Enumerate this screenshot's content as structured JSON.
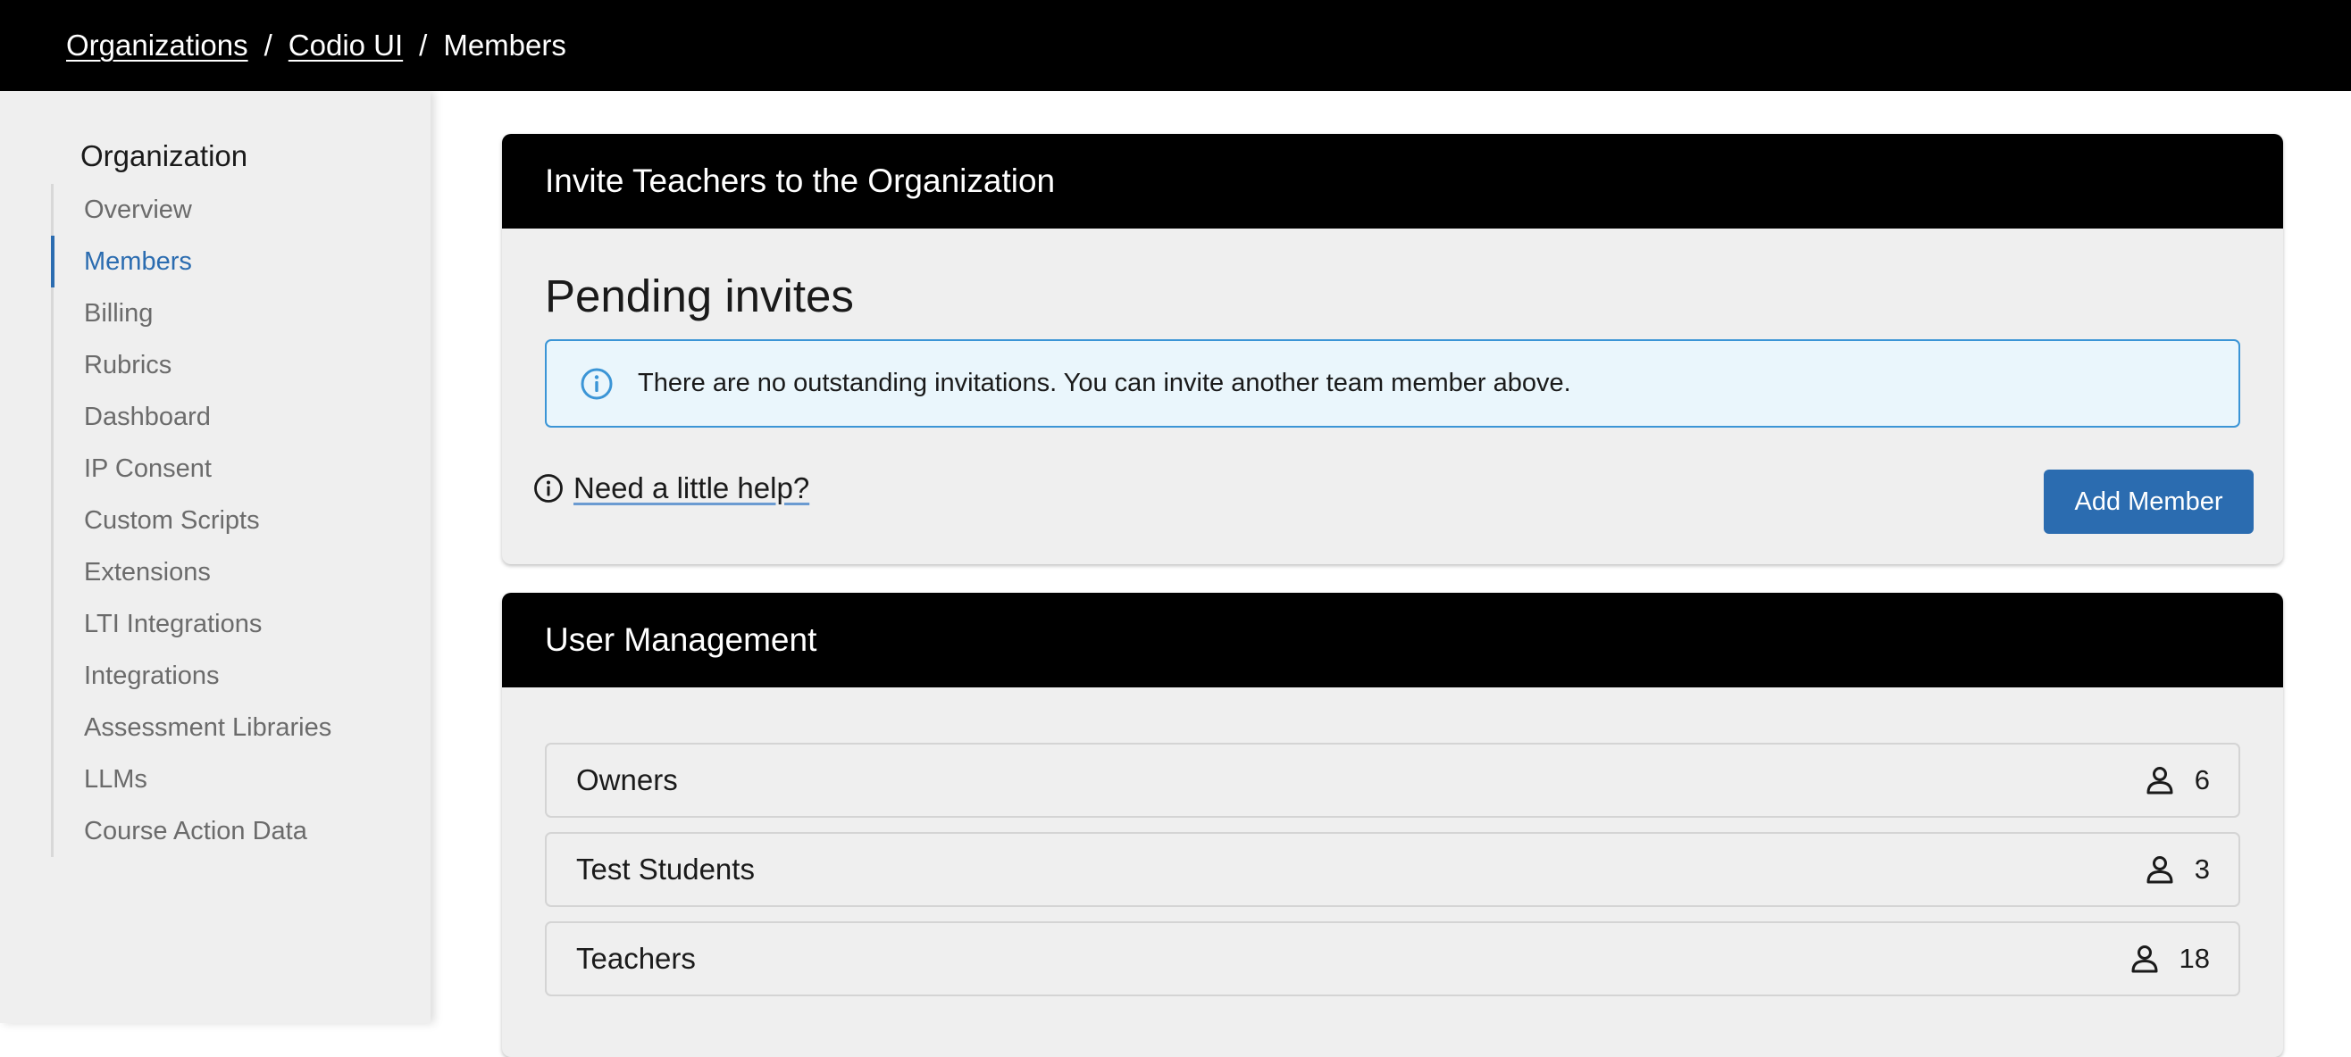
{
  "breadcrumb": {
    "items": [
      "Organizations",
      "Codio UI"
    ],
    "separator": "/",
    "current": "Members"
  },
  "sidebar": {
    "title": "Organization",
    "items": [
      {
        "label": "Overview"
      },
      {
        "label": "Members",
        "active": true
      },
      {
        "label": "Billing"
      },
      {
        "label": "Rubrics"
      },
      {
        "label": "Dashboard"
      },
      {
        "label": "IP Consent"
      },
      {
        "label": "Custom Scripts"
      },
      {
        "label": "Extensions"
      },
      {
        "label": "LTI Integrations"
      },
      {
        "label": "Integrations"
      },
      {
        "label": "Assessment Libraries"
      },
      {
        "label": "LLMs"
      },
      {
        "label": "Course Action Data"
      }
    ]
  },
  "invite_card": {
    "header": "Invite Teachers to the Organization",
    "pending_title": "Pending invites",
    "info_message": "There are no outstanding invitations. You can invite another team member above.",
    "help_link": "Need a little help?",
    "add_button": "Add Member"
  },
  "users_card": {
    "header": "User Management",
    "groups": [
      {
        "name": "Owners",
        "count": "6"
      },
      {
        "name": "Test Students",
        "count": "3"
      },
      {
        "name": "Teachers",
        "count": "18"
      }
    ]
  },
  "colors": {
    "accent": "#2b6cb0",
    "header_bg": "#000000",
    "panel_bg": "#efefef",
    "info_bg": "#eaf6fc",
    "info_border": "#3b95d6"
  },
  "icons": {
    "info": "info-circle-icon",
    "help": "info-circle-icon",
    "user": "user-icon"
  }
}
